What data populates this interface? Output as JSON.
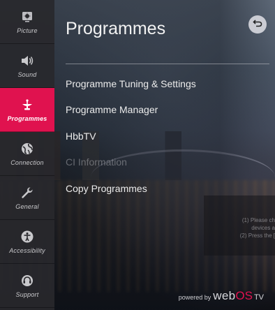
{
  "sidebar": {
    "items": [
      {
        "label": "Picture",
        "icon": "picture-icon",
        "active": false
      },
      {
        "label": "Sound",
        "icon": "speaker-icon",
        "active": false
      },
      {
        "label": "Programmes",
        "icon": "satellite-dish-icon",
        "active": true
      },
      {
        "label": "Connection",
        "icon": "globe-icon",
        "active": false
      },
      {
        "label": "General",
        "icon": "wrench-icon",
        "active": false
      },
      {
        "label": "Accessibility",
        "icon": "accessibility-icon",
        "active": false
      },
      {
        "label": "Support",
        "icon": "headset-icon",
        "active": false
      }
    ]
  },
  "main": {
    "title": "Programmes",
    "menu": [
      {
        "label": "Programme Tuning & Settings",
        "enabled": true
      },
      {
        "label": "Programme Manager",
        "enabled": true
      },
      {
        "label": "HbbTV",
        "enabled": true
      },
      {
        "label": "CI Information",
        "enabled": false
      },
      {
        "label": "Copy Programmes",
        "enabled": true
      }
    ]
  },
  "notice": {
    "line1": "(1) Please ch",
    "line2": "devices a",
    "line3": "(2) Press the ["
  },
  "footer": {
    "powered": "powered by",
    "web": "web",
    "os": "OS",
    "tv": "TV"
  },
  "colors": {
    "accent": "#e0124f",
    "sidebar_bg": "#28282c",
    "text": "#ececec"
  }
}
